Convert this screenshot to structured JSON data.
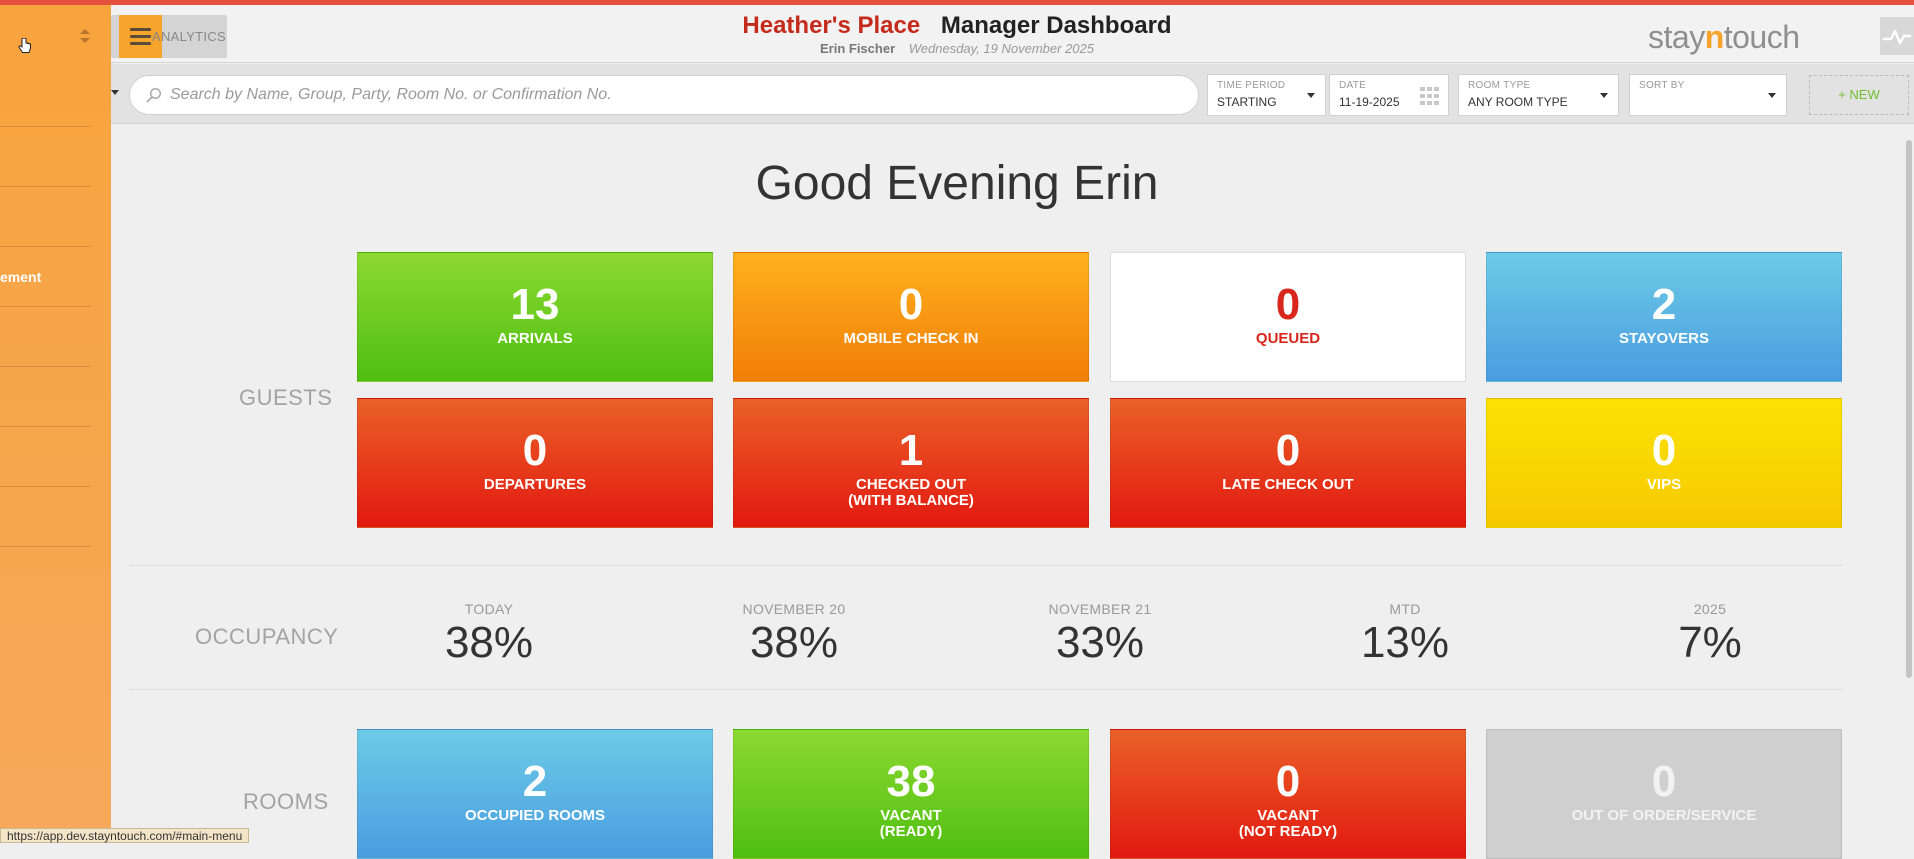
{
  "header": {
    "menu_label": "ANALYTICS",
    "hotel_name": "Heather's Place",
    "dashboard_title": "Manager Dashboard",
    "user_name": "Erin Fischer",
    "date_text": "Wednesday, 19 November 2025",
    "brand": {
      "pre": "stay",
      "mid": "n",
      "post": "touch"
    }
  },
  "sidebar": {
    "items": [
      "",
      "",
      "",
      "ement",
      "",
      "",
      "",
      ""
    ]
  },
  "filters": {
    "search_placeholder": "Search by Name, Group, Party, Room No. or Confirmation No.",
    "time_period": {
      "label": "TIME PERIOD",
      "value": "STARTING"
    },
    "date": {
      "label": "DATE",
      "value": "11-19-2025"
    },
    "room_type": {
      "label": "ROOM TYPE",
      "value": "ANY ROOM TYPE"
    },
    "sort_by": {
      "label": "SORT BY",
      "value": ""
    },
    "new_label": "+ NEW"
  },
  "greeting": "Good Evening Erin",
  "sections": {
    "guests": "GUESTS",
    "occupancy": "OCCUPANCY",
    "rooms": "ROOMS"
  },
  "guest_tiles": [
    {
      "count": "13",
      "label": "ARRIVALS"
    },
    {
      "count": "0",
      "label": "MOBILE CHECK IN"
    },
    {
      "count": "0",
      "label": "QUEUED"
    },
    {
      "count": "2",
      "label": "STAYOVERS"
    },
    {
      "count": "0",
      "label": "DEPARTURES"
    },
    {
      "count": "1",
      "label": "CHECKED OUT\n(WITH BALANCE)"
    },
    {
      "count": "0",
      "label": "LATE CHECK OUT"
    },
    {
      "count": "0",
      "label": "VIPS"
    }
  ],
  "occupancy": [
    {
      "label": "TODAY",
      "value": "38%"
    },
    {
      "label": "NOVEMBER 20",
      "value": "38%"
    },
    {
      "label": "NOVEMBER 21",
      "value": "33%"
    },
    {
      "label": "MTD",
      "value": "13%"
    },
    {
      "label": "2025",
      "value": "7%"
    }
  ],
  "room_tiles": [
    {
      "count": "2",
      "label": "OCCUPIED ROOMS"
    },
    {
      "count": "38",
      "label": "VACANT\n(READY)"
    },
    {
      "count": "0",
      "label": "VACANT\n(NOT READY)"
    },
    {
      "count": "0",
      "label": "OUT OF ORDER/SERVICE"
    }
  ],
  "status_url": "https://app.dev.stayntouch.com/#main-menu",
  "colors": {
    "sidebar": "#f7a33d",
    "hotel_name": "#c52a1a",
    "brand_accent": "#f6a42c",
    "green": "#4fbf10",
    "orange": "#f17d05",
    "blue": "#4a9de0",
    "red": "#e21910",
    "yellow": "#f6c900",
    "gray": "#cfcfcf"
  },
  "icons": [
    "hamburger-icon",
    "search-icon",
    "calendar-icon",
    "chevron-down-icon",
    "sort-arrows-icon",
    "activity-icon",
    "pointer-cursor-icon"
  ]
}
